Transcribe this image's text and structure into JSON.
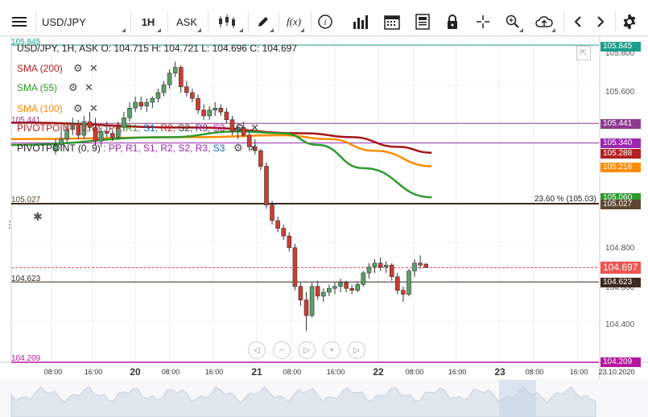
{
  "toolbar": {
    "symbol": "USD/JPY",
    "timeframe": "1H",
    "price_type": "ASK",
    "fx_label": "f(x)"
  },
  "chart": {
    "header": "USD/JPY, 1H, ASK  O: 104.715 H: 104.721 L: 104.696 C: 104.697",
    "indicators": [
      {
        "name": "SMA (200)",
        "color": "#b22222"
      },
      {
        "name": "SMA (55)",
        "color": "#2e9a2e"
      },
      {
        "name": "SMA (100)",
        "color": "#ff8c00"
      }
    ],
    "pivots": [
      {
        "name": "PIVOTPOINT (0, 8)",
        "color": "#b22222"
      },
      {
        "name": "PIVOTPOINT (0, 9)",
        "color": "#222222"
      }
    ],
    "pivot_params": [
      {
        "text": ": PP,",
        "color": "#b22222"
      },
      {
        "text": "R1,",
        "color": "#2e9a2e"
      },
      {
        "text": "S1,",
        "color": "#1565c0"
      },
      {
        "text": "R2,",
        "color": "#b22222"
      },
      {
        "text": "S2,",
        "color": "#333333"
      },
      {
        "text": "R3,",
        "color": "#6b1d8c"
      },
      {
        "text": "S3",
        "color": "#b5179e"
      }
    ],
    "pivot_params_2": [
      {
        "text": ": PP,",
        "color": "#9c27b0"
      },
      {
        "text": "R1,",
        "color": "#9c27b0"
      },
      {
        "text": "S1,",
        "color": "#9c27b0"
      },
      {
        "text": "R2,",
        "color": "#9c27b0"
      },
      {
        "text": "S2,",
        "color": "#9c27b0"
      },
      {
        "text": "R3,",
        "color": "#9c27b0"
      },
      {
        "text": "S3",
        "color": "#1565c0"
      }
    ],
    "fib_label": "23.60 % (105.03)",
    "price_axis_ticks": [
      "105.800",
      "105.600",
      "104.800",
      "104.600",
      "104.400"
    ],
    "left_labels": [
      "105.845",
      "105.441",
      "105.027",
      "104.623",
      "104.209"
    ],
    "price_tags": [
      {
        "value": "105.845",
        "color": "#1a9e8a"
      },
      {
        "value": "105.441",
        "color": "#8e3a8e"
      },
      {
        "value": "105.340",
        "color": "#9c27b0"
      },
      {
        "value": "105.288",
        "color": "#b22222"
      },
      {
        "value": "105.216",
        "color": "#ff8c00"
      },
      {
        "value": "105.060",
        "color": "#2e9a2e"
      },
      {
        "value": "105.027",
        "color": "#5d4632"
      },
      {
        "value": "104.697",
        "color": "#ef5350"
      },
      {
        "value": "104.623",
        "color": "#3d2a1e"
      },
      {
        "value": "104.209",
        "color": "#b5179e"
      }
    ],
    "time_axis": [
      "08:00",
      "16:00",
      "20",
      "08:00",
      "16:00",
      "21",
      "08:00",
      "16:00",
      "22",
      "08:00",
      "16:00",
      "23",
      "08:00",
      "16:00",
      "23.10.2020"
    ]
  },
  "chart_data": {
    "type": "candlestick",
    "symbol": "USD/JPY",
    "interval": "1H",
    "y_range": [
      104.209,
      105.845
    ],
    "levels": [
      105.845,
      105.441,
      105.34,
      105.027,
      104.623,
      104.209
    ],
    "fib_level": 105.03,
    "last_price": 104.697,
    "candles": [
      [
        105.3,
        105.36,
        105.28,
        105.33
      ],
      [
        105.33,
        105.4,
        105.3,
        105.36
      ],
      [
        105.36,
        105.44,
        105.34,
        105.41
      ],
      [
        105.41,
        105.47,
        105.38,
        105.44
      ],
      [
        105.44,
        105.46,
        105.36,
        105.38
      ],
      [
        105.38,
        105.48,
        105.36,
        105.45
      ],
      [
        105.45,
        105.5,
        105.4,
        105.42
      ],
      [
        105.42,
        105.47,
        105.33,
        105.35
      ],
      [
        105.35,
        105.42,
        105.32,
        105.4
      ],
      [
        105.4,
        105.45,
        105.37,
        105.39
      ],
      [
        105.39,
        105.41,
        105.35,
        105.37
      ],
      [
        105.37,
        105.45,
        105.36,
        105.42
      ],
      [
        105.42,
        105.5,
        105.4,
        105.47
      ],
      [
        105.47,
        105.55,
        105.45,
        105.52
      ],
      [
        105.52,
        105.58,
        105.5,
        105.55
      ],
      [
        105.55,
        105.58,
        105.51,
        105.53
      ],
      [
        105.53,
        105.57,
        105.5,
        105.55
      ],
      [
        105.55,
        105.58,
        105.52,
        105.57
      ],
      [
        105.57,
        105.62,
        105.55,
        105.6
      ],
      [
        105.6,
        105.66,
        105.58,
        105.64
      ],
      [
        105.64,
        105.72,
        105.62,
        105.7
      ],
      [
        105.7,
        105.76,
        105.68,
        105.73
      ],
      [
        105.73,
        105.74,
        105.6,
        105.63
      ],
      [
        105.63,
        105.66,
        105.58,
        105.6
      ],
      [
        105.6,
        105.62,
        105.55,
        105.57
      ],
      [
        105.57,
        105.59,
        105.49,
        105.51
      ],
      [
        105.51,
        105.54,
        105.46,
        105.48
      ],
      [
        105.48,
        105.53,
        105.46,
        105.51
      ],
      [
        105.51,
        105.55,
        105.48,
        105.52
      ],
      [
        105.52,
        105.54,
        105.48,
        105.5
      ],
      [
        105.5,
        105.52,
        105.44,
        105.46
      ],
      [
        105.46,
        105.48,
        105.38,
        105.4
      ],
      [
        105.4,
        105.44,
        105.36,
        105.42
      ],
      [
        105.42,
        105.45,
        105.37,
        105.38
      ],
      [
        105.38,
        105.4,
        105.3,
        105.32
      ],
      [
        105.32,
        105.36,
        105.28,
        105.3
      ],
      [
        105.3,
        105.31,
        105.2,
        105.22
      ],
      [
        105.22,
        105.24,
        105.0,
        105.02
      ],
      [
        105.02,
        105.04,
        104.92,
        104.94
      ],
      [
        104.94,
        104.96,
        104.88,
        104.9
      ],
      [
        104.9,
        104.92,
        104.84,
        104.86
      ],
      [
        104.86,
        104.88,
        104.78,
        104.8
      ],
      [
        104.8,
        104.82,
        104.58,
        104.6
      ],
      [
        104.6,
        104.62,
        104.5,
        104.53
      ],
      [
        104.53,
        104.57,
        104.37,
        104.45
      ],
      [
        104.45,
        104.62,
        104.44,
        104.6
      ],
      [
        104.6,
        104.63,
        104.53,
        104.55
      ],
      [
        104.55,
        104.59,
        104.52,
        104.57
      ],
      [
        104.57,
        104.61,
        104.55,
        104.59
      ],
      [
        104.59,
        104.62,
        104.56,
        104.6
      ],
      [
        104.6,
        104.64,
        104.57,
        104.62
      ],
      [
        104.62,
        104.63,
        104.57,
        104.59
      ],
      [
        104.59,
        104.61,
        104.56,
        104.58
      ],
      [
        104.58,
        104.62,
        104.57,
        104.61
      ],
      [
        104.61,
        104.68,
        104.6,
        104.67
      ],
      [
        104.67,
        104.72,
        104.64,
        104.7
      ],
      [
        104.7,
        104.74,
        104.67,
        104.72
      ],
      [
        104.72,
        104.75,
        104.68,
        104.7
      ],
      [
        104.7,
        104.73,
        104.67,
        104.71
      ],
      [
        104.71,
        104.72,
        104.63,
        104.65
      ],
      [
        104.65,
        104.67,
        104.56,
        104.58
      ],
      [
        104.58,
        104.6,
        104.52,
        104.56
      ],
      [
        104.56,
        104.69,
        104.55,
        104.68
      ],
      [
        104.68,
        104.74,
        104.65,
        104.72
      ],
      [
        104.72,
        104.76,
        104.69,
        104.71
      ],
      [
        104.715,
        104.721,
        104.696,
        104.697
      ]
    ],
    "sma_200": [
      [
        0,
        105.445
      ],
      [
        24,
        105.42
      ],
      [
        44,
        105.39
      ],
      [
        52,
        105.37
      ],
      [
        60,
        105.32
      ],
      [
        66,
        105.29
      ]
    ],
    "sma_100": [
      [
        0,
        105.36
      ],
      [
        24,
        105.37
      ],
      [
        40,
        105.38
      ],
      [
        48,
        105.36
      ],
      [
        56,
        105.3
      ],
      [
        66,
        105.22
      ]
    ],
    "sma_55": [
      [
        0,
        105.33
      ],
      [
        20,
        105.37
      ],
      [
        32,
        105.4
      ],
      [
        40,
        105.39
      ],
      [
        46,
        105.33
      ],
      [
        54,
        105.21
      ],
      [
        66,
        105.06
      ]
    ]
  }
}
